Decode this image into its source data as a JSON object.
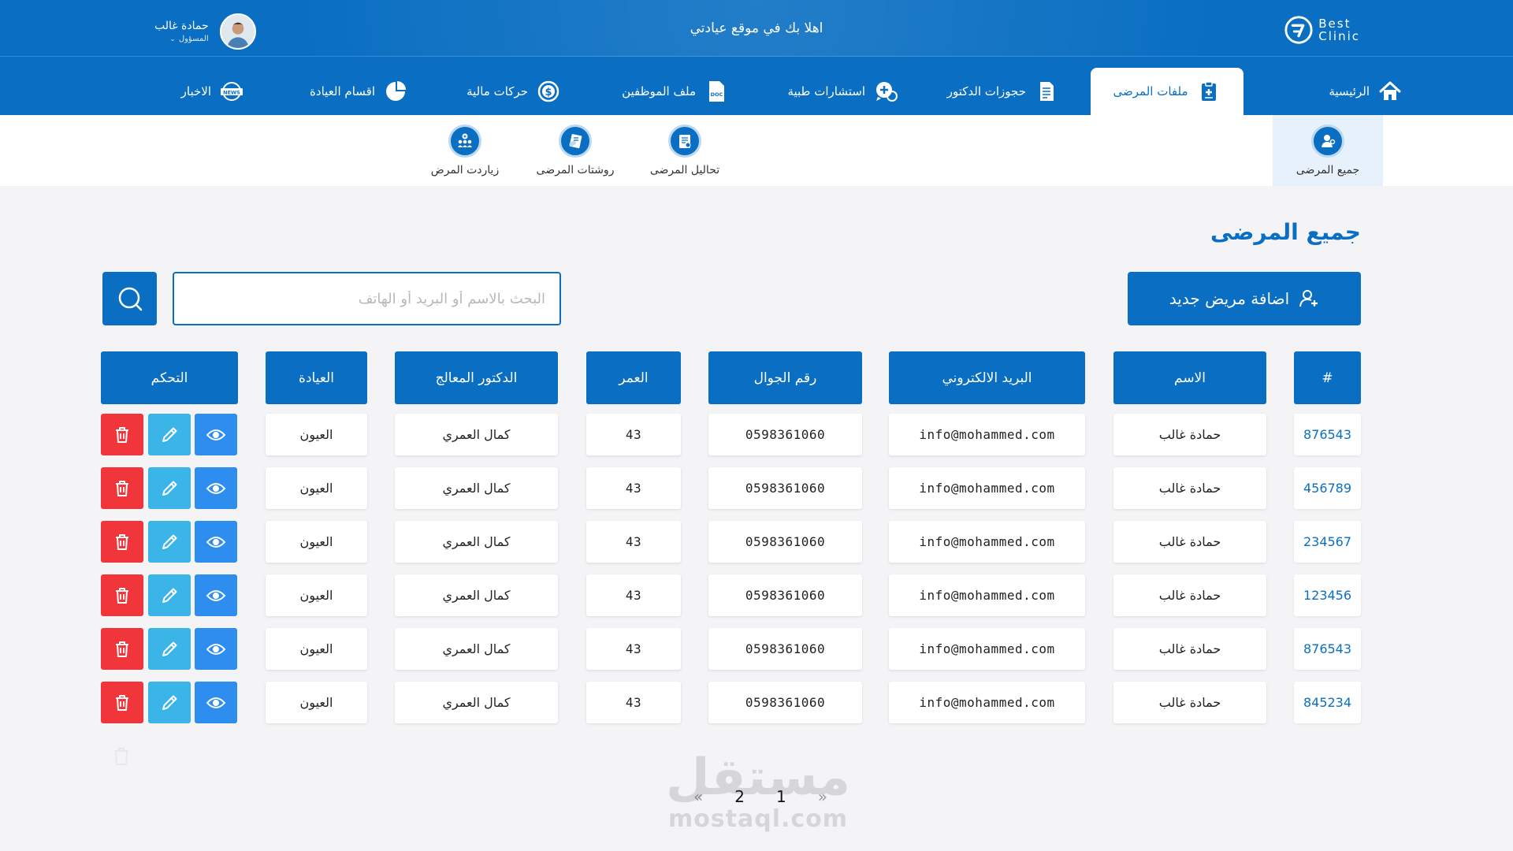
{
  "header": {
    "logo_line1": "Best",
    "logo_line2": "Clinic",
    "welcome": "اهلا بك في  موقع عيادتي",
    "user_name": "حمادة غالب",
    "user_role": "المسؤول"
  },
  "nav": {
    "items": [
      {
        "label": "الرئيسية",
        "icon": "home-icon"
      },
      {
        "label": "ملفات المرضى",
        "icon": "clipboard-medical-icon",
        "active": true
      },
      {
        "label": "حجوزات الدكتور",
        "icon": "document-list-icon"
      },
      {
        "label": "استشارات طبية",
        "icon": "chat-medical-icon"
      },
      {
        "label": "ملف الموظفين",
        "icon": "doc-file-icon"
      },
      {
        "label": "حركات مالية",
        "icon": "dollar-coin-icon"
      },
      {
        "label": "اقسام العيادة",
        "icon": "pie-chart-icon"
      },
      {
        "label": "الاخبار",
        "icon": "news-icon"
      }
    ]
  },
  "subnav": {
    "items": [
      {
        "label": "جميع المرضى",
        "icon": "patient-doctor-icon",
        "active": true
      },
      {
        "label": "زياردت المرض",
        "icon": "visits-group-icon"
      },
      {
        "label": "روشتات المرضى",
        "icon": "prescription-icon"
      },
      {
        "label": "تحاليل المرضى",
        "icon": "lab-analysis-icon"
      }
    ]
  },
  "page": {
    "title": "جميع المرضى",
    "add_button": "اضافة مريض جديد",
    "search_placeholder": "البحث بالاسم أو البريد أو الهاتف"
  },
  "table": {
    "headers": {
      "id": "#",
      "name": "الاسم",
      "email": "البريد الالكتروني",
      "phone": "رقم الجوال",
      "age": "العمر",
      "doctor": "الدكتور المعالج",
      "clinic": "العيادة",
      "actions": "التحكم"
    },
    "rows": [
      {
        "id": "876543",
        "name": "حمادة غالب",
        "email": "info@mohammed.com",
        "phone": "0598361060",
        "age": "43",
        "doctor": "كمال العمري",
        "clinic": "العيون"
      },
      {
        "id": "456789",
        "name": "حمادة غالب",
        "email": "info@mohammed.com",
        "phone": "0598361060",
        "age": "43",
        "doctor": "كمال العمري",
        "clinic": "العيون"
      },
      {
        "id": "234567",
        "name": "حمادة غالب",
        "email": "info@mohammed.com",
        "phone": "0598361060",
        "age": "43",
        "doctor": "كمال العمري",
        "clinic": "العيون"
      },
      {
        "id": "123456",
        "name": "حمادة غالب",
        "email": "info@mohammed.com",
        "phone": "0598361060",
        "age": "43",
        "doctor": "كمال العمري",
        "clinic": "العيون"
      },
      {
        "id": "876543",
        "name": "حمادة غالب",
        "email": "info@mohammed.com",
        "phone": "0598361060",
        "age": "43",
        "doctor": "كمال العمري",
        "clinic": "العيون"
      },
      {
        "id": "845234",
        "name": "حمادة غالب",
        "email": "info@mohammed.com",
        "phone": "0598361060",
        "age": "43",
        "doctor": "كمال العمري",
        "clinic": "العيون"
      }
    ]
  },
  "pagination": {
    "prev": "«",
    "pages": [
      "2",
      "1"
    ],
    "next": "»"
  },
  "watermark": {
    "arabic": "مستقل",
    "latin": "mostaql.com"
  },
  "colors": {
    "primary": "#0a6fc2",
    "view": "#2d8ef0",
    "edit": "#3bb4e8",
    "delete": "#f0363a"
  }
}
